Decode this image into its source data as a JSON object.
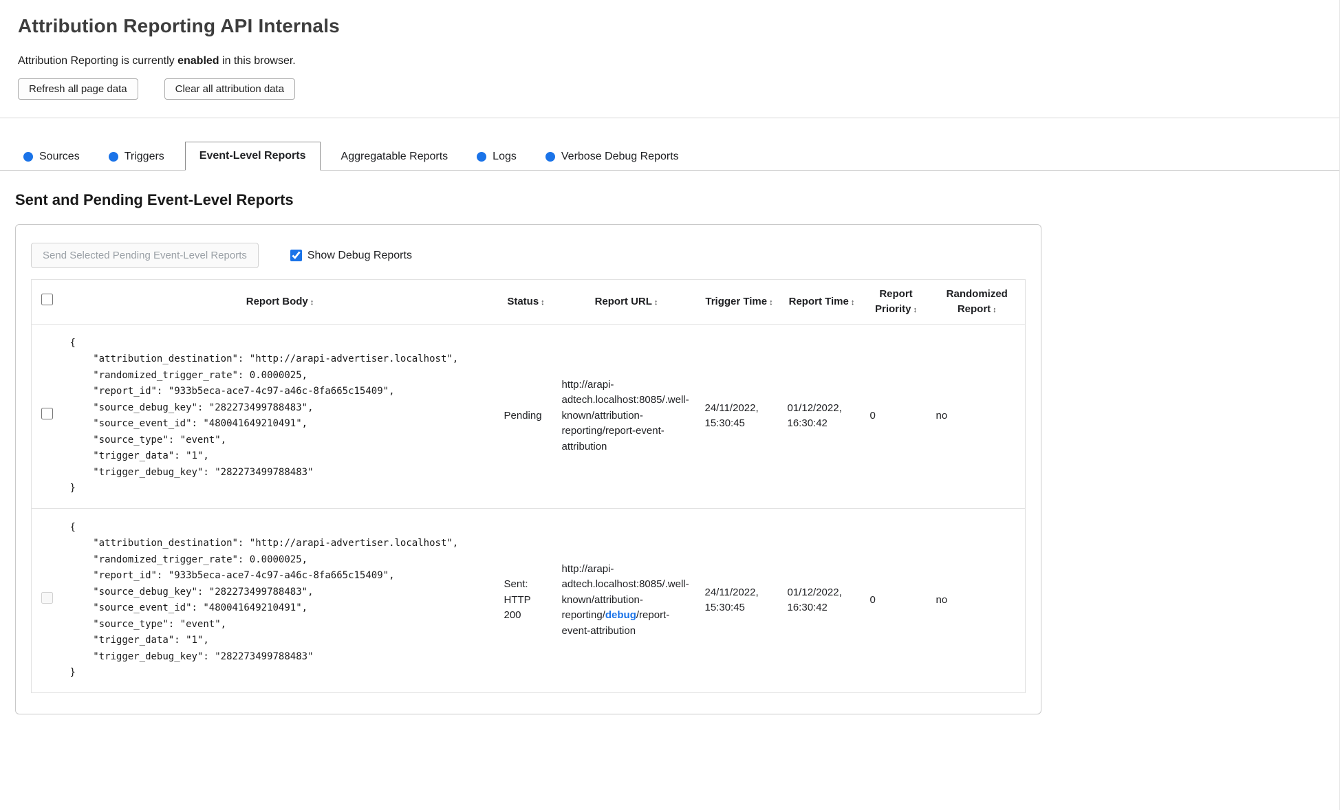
{
  "page": {
    "title": "Attribution Reporting API Internals",
    "status": {
      "prefix": "Attribution Reporting is currently ",
      "emphasis": "enabled",
      "suffix": " in this browser."
    },
    "buttons": {
      "refresh": "Refresh all page data",
      "clear": "Clear all attribution data"
    }
  },
  "tabs": [
    {
      "label": "Sources",
      "has_dot": true,
      "active": false
    },
    {
      "label": "Triggers",
      "has_dot": true,
      "active": false
    },
    {
      "label": "Event-Level Reports",
      "has_dot": false,
      "active": true
    },
    {
      "label": "Aggregatable Reports",
      "has_dot": false,
      "active": false
    },
    {
      "label": "Logs",
      "has_dot": true,
      "active": false
    },
    {
      "label": "Verbose Debug Reports",
      "has_dot": true,
      "active": false
    }
  ],
  "colors": {
    "accent_blue": "#1a73e8"
  },
  "section": {
    "heading": "Sent and Pending Event-Level Reports",
    "send_button": "Send Selected Pending Event-Level Reports",
    "send_button_enabled": false,
    "show_debug_label": "Show Debug Reports",
    "show_debug_checked": true
  },
  "table": {
    "sort_icon": "↕",
    "headers": {
      "report_body": "Report Body",
      "status": "Status",
      "report_url": "Report URL",
      "trigger_time": "Trigger Time",
      "report_time": "Report Time",
      "report_priority": "Report Priority",
      "randomized_report": "Randomized Report"
    },
    "rows": [
      {
        "selected": false,
        "checkbox_enabled": true,
        "report_body": "{\n    \"attribution_destination\": \"http://arapi-advertiser.localhost\",\n    \"randomized_trigger_rate\": 0.0000025,\n    \"report_id\": \"933b5eca-ace7-4c97-a46c-8fa665c15409\",\n    \"source_debug_key\": \"282273499788483\",\n    \"source_event_id\": \"480041649210491\",\n    \"source_type\": \"event\",\n    \"trigger_data\": \"1\",\n    \"trigger_debug_key\": \"282273499788483\"\n}",
        "status": "Pending",
        "report_url": {
          "before": "http://arapi-adtech.localhost:8085/.well-known/attribution-reporting/report-event-attribution",
          "highlight": "",
          "after": ""
        },
        "trigger_time": "24/11/2022, 15:30:45",
        "report_time": "01/12/2022, 16:30:42",
        "report_priority": "0",
        "randomized_report": "no"
      },
      {
        "selected": false,
        "checkbox_enabled": false,
        "report_body": "{\n    \"attribution_destination\": \"http://arapi-advertiser.localhost\",\n    \"randomized_trigger_rate\": 0.0000025,\n    \"report_id\": \"933b5eca-ace7-4c97-a46c-8fa665c15409\",\n    \"source_debug_key\": \"282273499788483\",\n    \"source_event_id\": \"480041649210491\",\n    \"source_type\": \"event\",\n    \"trigger_data\": \"1\",\n    \"trigger_debug_key\": \"282273499788483\"\n}",
        "status": "Sent: HTTP 200",
        "report_url": {
          "before": "http://arapi-adtech.localhost:8085/.well-known/attribution-reporting/",
          "highlight": "debug",
          "after": "/report-event-attribution"
        },
        "trigger_time": "24/11/2022, 15:30:45",
        "report_time": "01/12/2022, 16:30:42",
        "report_priority": "0",
        "randomized_report": "no"
      }
    ]
  }
}
